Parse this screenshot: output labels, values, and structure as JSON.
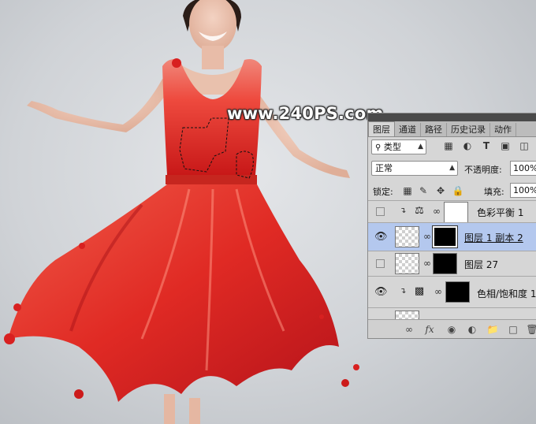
{
  "watermark": "www.240PS.com",
  "panel": {
    "tabs": [
      "图层",
      "通道",
      "路径",
      "历史记录",
      "动作"
    ],
    "active_tab": "图层",
    "filter": {
      "label": "类型",
      "icon": "search-icon"
    },
    "blend_mode": "正常",
    "opacity": {
      "label": "不透明度:",
      "value": "100%"
    },
    "lock": {
      "label": "锁定:"
    },
    "fill": {
      "label": "填充:",
      "value": "100%"
    },
    "layers": [
      {
        "name": "色彩平衡 1",
        "visible": false,
        "clipped": true,
        "type": "color-balance"
      },
      {
        "name": "图层 1 副本 2",
        "visible": true,
        "clipped": false,
        "type": "pixel",
        "selected": true
      },
      {
        "name": "图层 27",
        "visible": false,
        "clipped": false,
        "type": "pixel"
      },
      {
        "name": "色相/饱和度 1",
        "visible": true,
        "clipped": true,
        "type": "hue-saturation"
      }
    ],
    "bottom_icons": [
      "link-icon",
      "fx-icon",
      "mask-icon",
      "adjustment-icon",
      "folder-icon",
      "new-layer-icon",
      "trash-icon"
    ],
    "fx_label": "fx"
  }
}
